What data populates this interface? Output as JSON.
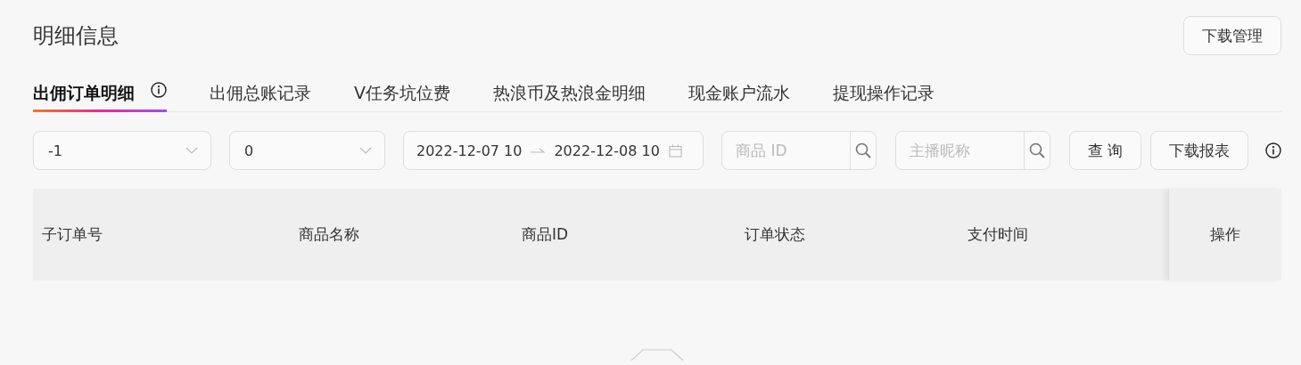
{
  "title": "明细信息",
  "download_manager_button": "下载管理",
  "tabs": [
    {
      "label": "出佣订单明细",
      "selected": true,
      "info": true
    },
    {
      "label": "出佣总账记录",
      "selected": false,
      "info": false
    },
    {
      "label": "V任务坑位费",
      "selected": false,
      "info": false
    },
    {
      "label": "热浪币及热浪金明细",
      "selected": false,
      "info": false
    },
    {
      "label": "现金账户流水",
      "selected": false,
      "info": false
    },
    {
      "label": "提现操作记录",
      "selected": false,
      "info": false
    }
  ],
  "filters": {
    "select_1": "-1",
    "select_2": "0",
    "date_start": "2022-12-07 10",
    "date_end": "2022-12-08 10",
    "product_id_placeholder": "商品 ID",
    "anchor_placeholder": "主播昵称",
    "query_button": "查 询",
    "download_report_button": "下载报表"
  },
  "table": {
    "columns": [
      "子订单号",
      "商品名称",
      "商品ID",
      "订单状态",
      "支付时间",
      "操作"
    ]
  }
}
